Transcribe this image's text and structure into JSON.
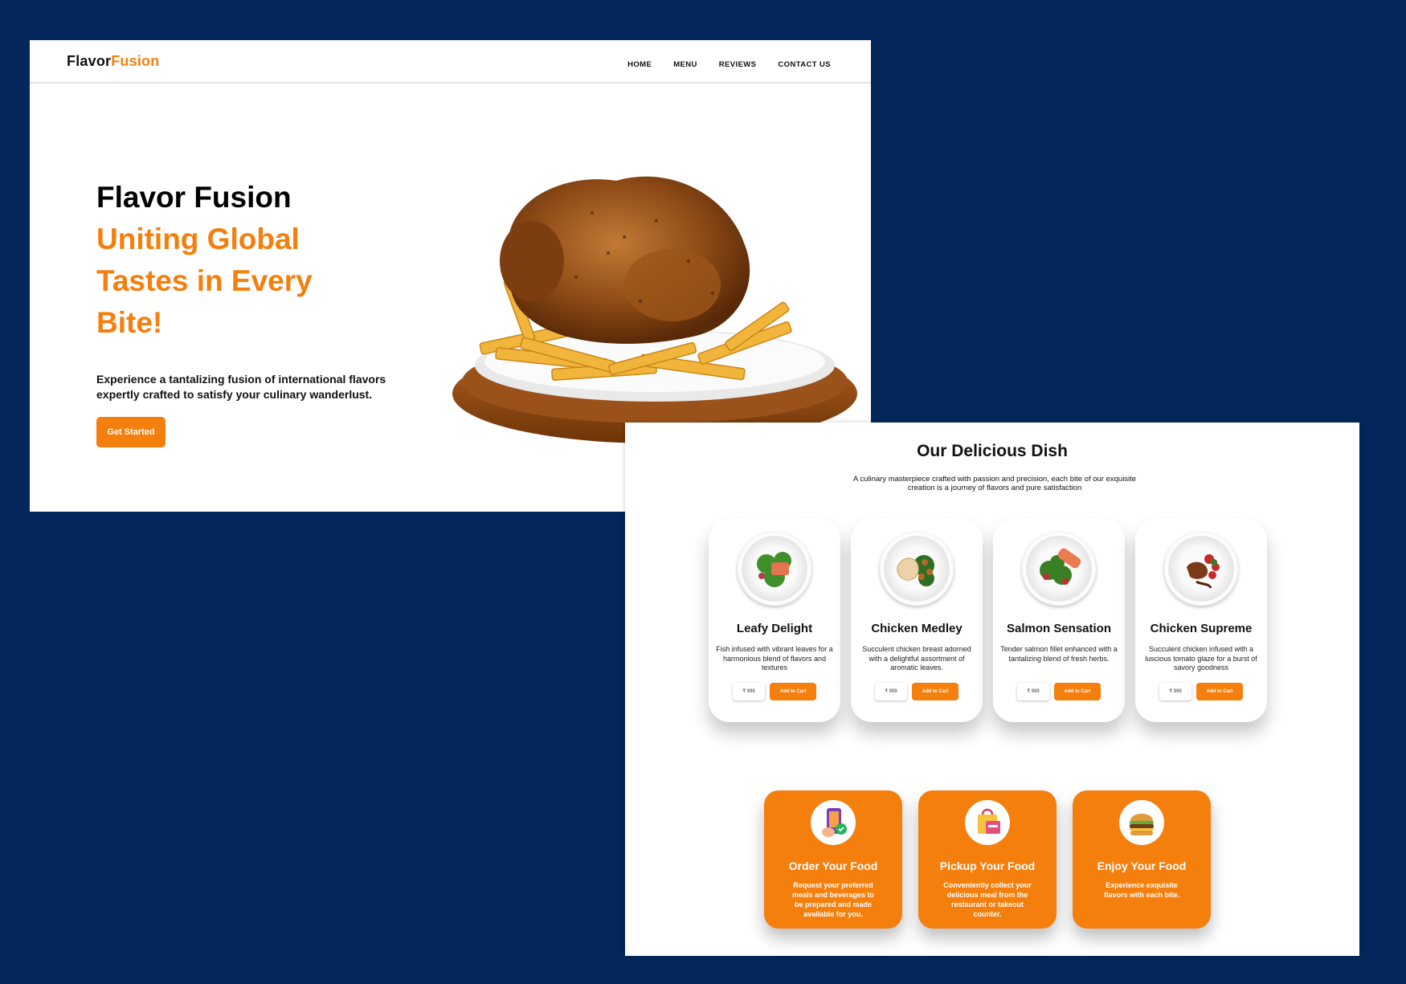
{
  "screen1": {
    "logo": {
      "part1": "Flavor",
      "part2": "Fusion"
    },
    "nav": [
      {
        "label": "HOME"
      },
      {
        "label": "MENU"
      },
      {
        "label": "REVIEWS"
      },
      {
        "label": "CONTACT US"
      }
    ],
    "hero": {
      "title": "Flavor Fusion",
      "tagline_lines": [
        "Uniting Global",
        "Tastes in Every",
        "Bite!"
      ],
      "description": "Experience a tantalizing fusion of international flavors expertly crafted to satisfy your culinary wanderlust.",
      "cta": "Get Started",
      "image": "roast-chicken-fries-plate"
    }
  },
  "screen2": {
    "title": "Our Delicious Dish",
    "subtitle": "A culinary masterpiece crafted with passion and precision, each bite of our exquisite creation is a journey of flavors and pure satisfaction",
    "dishes": [
      {
        "name": "Leafy Delight",
        "description": "Fish infused with vibrant leaves for a harmonious blend of flavors and textures",
        "price": "₹ 999",
        "button": "Add to Cart",
        "image": "salad-fish-plate"
      },
      {
        "name": "Chicken Medley",
        "description": "Succulent chicken breast adorned with a delightful assortment of aromatic leaves.",
        "price": "₹ 999",
        "button": "Add to Cart",
        "image": "chicken-breast-plate"
      },
      {
        "name": "Salmon Sensation",
        "description": "Tender salmon fillet enhanced with a tantalizing blend of fresh herbs.",
        "price": "₹ 999",
        "button": "Add to Cart",
        "image": "salmon-plate"
      },
      {
        "name": "Chicken Supreme",
        "description": "Succulent chicken infused with a luscious tomato glaze for a burst of savory goodness",
        "price": "₹ 999",
        "button": "Add to Cart",
        "image": "glazed-chicken-plate"
      }
    ],
    "steps": [
      {
        "title": "Order Your Food",
        "description": "Request your preferred meals and beverages to be prepared and made available for you.",
        "icon": "phone-order-icon"
      },
      {
        "title": "Pickup Your Food",
        "description": "Conveniently collect your delicious meal from the restaurant or takeout counter.",
        "icon": "shopping-bag-icon"
      },
      {
        "title": "Enjoy Your Food",
        "description": "Experience exquisite flavors with each bite.",
        "icon": "burger-icon"
      }
    ]
  },
  "colors": {
    "accent": "#f47f0d",
    "background": "#03275a",
    "text": "#111111"
  }
}
